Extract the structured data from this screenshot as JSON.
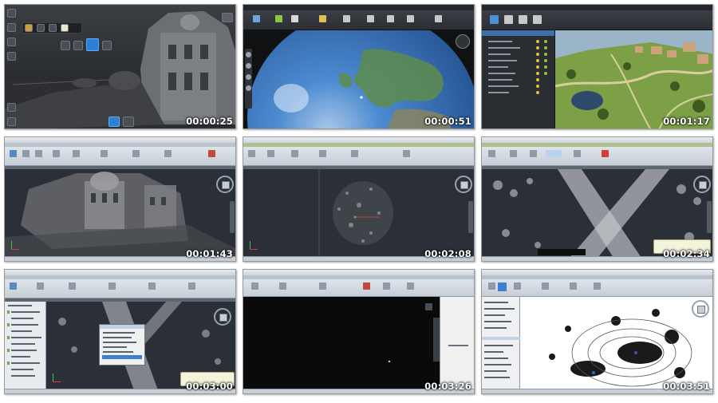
{
  "thumbnails": [
    {
      "id": "t1",
      "timestamp": "00:00:25",
      "app": "recap-dark"
    },
    {
      "id": "t2",
      "timestamp": "00:00:51",
      "app": "globe"
    },
    {
      "id": "t3",
      "timestamp": "00:01:17",
      "app": "infraworks"
    },
    {
      "id": "t4",
      "timestamp": "00:01:43",
      "app": "autocad-pointcloud"
    },
    {
      "id": "t5",
      "timestamp": "00:02:08",
      "app": "autocad-sparse"
    },
    {
      "id": "t6",
      "timestamp": "00:02:34",
      "app": "autocad-crossroad"
    },
    {
      "id": "t7",
      "timestamp": "00:03:00",
      "app": "autocad-dialog"
    },
    {
      "id": "t8",
      "timestamp": "00:03:26",
      "app": "autocad-black"
    },
    {
      "id": "t9",
      "timestamp": "00:03:51",
      "app": "revit-white"
    }
  ],
  "colors": {
    "ribbon_green": "#8ec63f",
    "timestamp_text": "#ffffff",
    "globe_blue": "#3a7fcf",
    "viewport_dark": "#2b3038"
  }
}
